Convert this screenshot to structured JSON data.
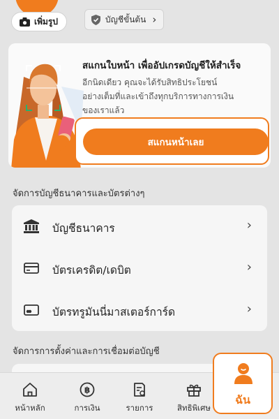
{
  "profile": {
    "photo_button_label": "เพิ่มรูป",
    "tier_button_label": "บัญชีขั้นต้น"
  },
  "scan_card": {
    "title": "สแกนใบหน้า เพื่ออัปเกรดบัญชีให้สำเร็จ",
    "description_line1": "อีกนิดเดียว คุณจะได้รับสิทธิประโยชน์",
    "description_line2": "อย่างเต็มที่และเข้าถึงทุกบริการทางการเงิน",
    "description_line3": "ของเราแล้ว",
    "button_label": "สแกนหน้าเลย"
  },
  "accounts_section": {
    "title": "จัดการบัญชีธนาคารและบัตรต่างๆ",
    "items": [
      {
        "label": "บัญชีธนาคาร",
        "icon": "bank-icon"
      },
      {
        "label": "บัตรเครดิต/เดบิต",
        "icon": "credit-card-icon"
      },
      {
        "label": "บัตรทรูมันนี่มาสเตอร์การ์ด",
        "icon": "prepaid-card-icon"
      }
    ]
  },
  "settings_section": {
    "title": "จัดการการตั้งค่าและการเชื่อมต่อบัญชี"
  },
  "bottom_nav": {
    "items": [
      {
        "label": "หน้าหลัก",
        "icon": "home-icon"
      },
      {
        "label": "การเงิน",
        "icon": "baht-coin-icon"
      },
      {
        "label": "รายการ",
        "icon": "transactions-icon"
      },
      {
        "label": "สิทธิพิเศษ",
        "icon": "gift-icon"
      },
      {
        "label": "ฉัน",
        "icon": "person-icon"
      }
    ]
  },
  "colors": {
    "accent": "#f07c1e",
    "background": "#e4e4e4",
    "card": "#f6f6f6"
  }
}
